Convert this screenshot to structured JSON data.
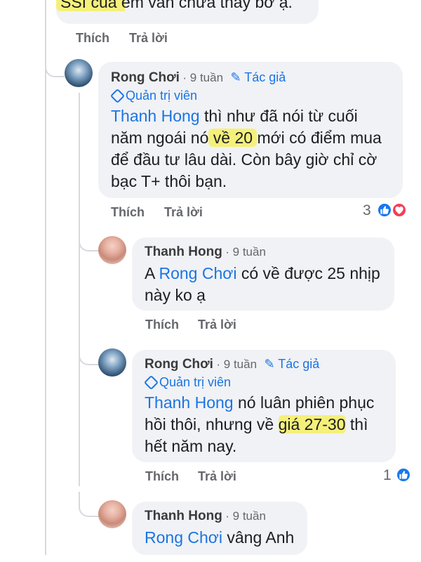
{
  "top_comment": {
    "text_end": "SSI của em vẫn chưa thấy bờ ạ.",
    "like": "Thích",
    "reply": "Trả lời"
  },
  "comments": [
    {
      "name": "Rong Chơi",
      "time": "9 tuần",
      "author_badge": "Tác giả",
      "admin_badge": "Quản trị viên",
      "tag": "Thanh Hong",
      "line1_rest": " thì như đã nói từ cuối",
      "line2_a": "năm ngoái nó",
      "line2_hl": " về 20 ",
      "line2_b": " mới có điểm mua",
      "line3": "để đầu tư lâu dài. Còn bây giờ chỉ cờ",
      "line4": "bạc T+  thôi bạn.",
      "like": "Thích",
      "reply": "Trả lời",
      "reaction_count": "3"
    },
    {
      "name": "Thanh Hong",
      "time": "9 tuần",
      "line1_a": "A ",
      "tag": "Rong Chơi",
      "line1_b": " có về được 25 nhịp",
      "line2": "này ko ạ",
      "like": "Thích",
      "reply": "Trả lời"
    },
    {
      "name": "Rong Chơi",
      "time": "9 tuần",
      "author_badge": "Tác giả",
      "admin_badge": "Quản trị viên",
      "tag": "Thanh Hong",
      "line1_rest": "  nó luân phiên phục",
      "line2_a": "hồi thôi, nhưng về ",
      "line2_hl": "giá 27-30",
      "line2_b": "  thì",
      "line3": "hết năm nay.",
      "like": "Thích",
      "reply": "Trả lời",
      "reaction_count": "1"
    },
    {
      "name": "Thanh Hong",
      "time": "9 tuần",
      "tag": "Rong Chơi",
      "line1_b": " vâng Anh"
    }
  ],
  "colors": {
    "link": "#1b74e4",
    "highlight": "#f5f07a",
    "bubble": "#f0f2f5",
    "like_reaction": "#1877f2",
    "love_reaction": "#f33e58"
  }
}
